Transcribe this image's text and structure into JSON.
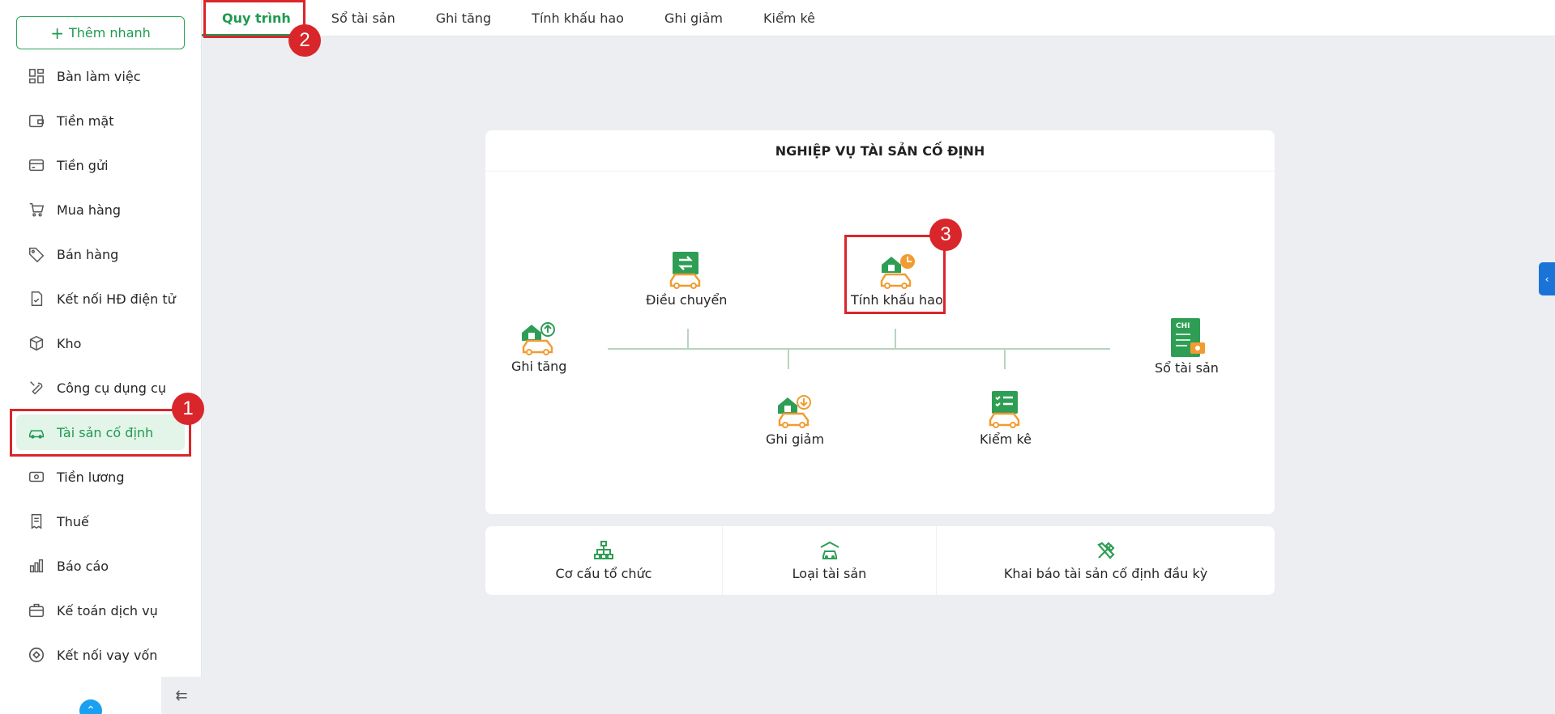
{
  "sidebar": {
    "quick_add_label": "Thêm nhanh",
    "items": [
      {
        "label": "Bàn làm việc",
        "icon": "dashboard-icon"
      },
      {
        "label": "Tiền mặt",
        "icon": "wallet-icon"
      },
      {
        "label": "Tiền gửi",
        "icon": "card-icon"
      },
      {
        "label": "Mua hàng",
        "icon": "cart-icon"
      },
      {
        "label": "Bán hàng",
        "icon": "tag-icon"
      },
      {
        "label": "Kết nối HĐ điện tử",
        "icon": "invoice-icon"
      },
      {
        "label": "Kho",
        "icon": "box-icon"
      },
      {
        "label": "Công cụ dụng cụ",
        "icon": "wrench-icon"
      },
      {
        "label": "Tài sản cố định",
        "icon": "car-icon"
      },
      {
        "label": "Tiền lương",
        "icon": "money-icon"
      },
      {
        "label": "Thuế",
        "icon": "receipt-icon"
      },
      {
        "label": "Báo cáo",
        "icon": "chart-icon"
      },
      {
        "label": "Kế toán dịch vụ",
        "icon": "briefcase-icon"
      },
      {
        "label": "Kết nối vay vốn",
        "icon": "loan-icon"
      }
    ]
  },
  "tabs": [
    "Quy trình",
    "Sổ tài sản",
    "Ghi tăng",
    "Tính khấu hao",
    "Ghi giảm",
    "Kiểm kê"
  ],
  "card": {
    "title": "NGHIỆP VỤ TÀI SẢN CỐ ĐỊNH",
    "nodes": {
      "ghi_tang": "Ghi tăng",
      "dieu_chuyen": "Điều chuyển",
      "tinh_khau_hao": "Tính khấu hao",
      "ghi_giam": "Ghi giảm",
      "kiem_ke": "Kiểm kê",
      "so_tai_san": "Sổ tài sản",
      "so_badge": "CHI"
    }
  },
  "bottom": [
    "Cơ cấu tổ chức",
    "Loại tài sản",
    "Khai báo tài sản cố định đầu kỳ"
  ],
  "annotations": [
    "1",
    "2",
    "3"
  ],
  "colors": {
    "accent": "#1f9a50",
    "annotation": "#d9262b",
    "orange": "#f29b30"
  }
}
